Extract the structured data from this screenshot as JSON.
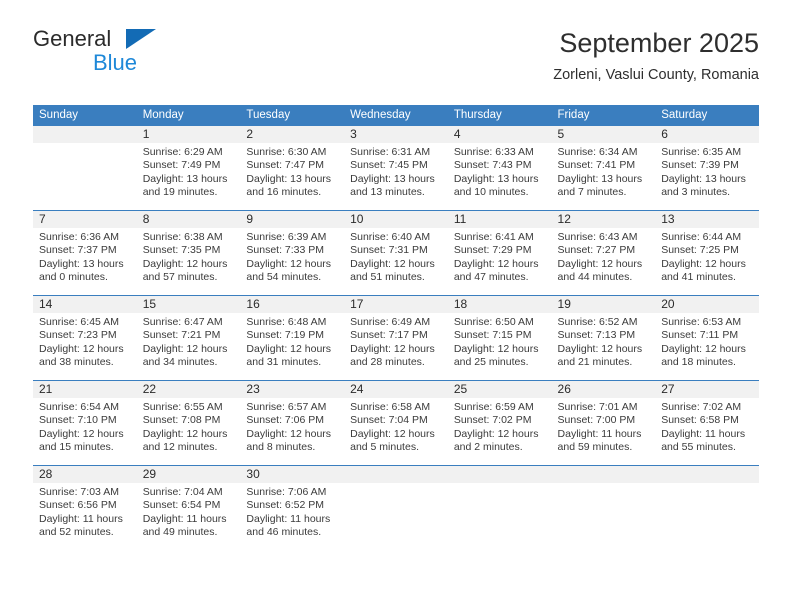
{
  "brand": {
    "name_part1": "General",
    "name_part2": "Blue",
    "triangle_color": "#136bb5",
    "blue_color": "#1e88d8"
  },
  "header": {
    "title": "September 2025",
    "subtitle": "Zorleni, Vaslui County, Romania"
  },
  "theme": {
    "header_bg": "#3a7ebf",
    "header_text": "#ffffff",
    "daynum_bg": "#f1f1f1",
    "row_divider": "#3a7ebf"
  },
  "weekdays": [
    "Sunday",
    "Monday",
    "Tuesday",
    "Wednesday",
    "Thursday",
    "Friday",
    "Saturday"
  ],
  "weeks": [
    [
      {
        "day": "",
        "sunrise": "",
        "sunset": "",
        "daylight1": "",
        "daylight2": ""
      },
      {
        "day": "1",
        "sunrise": "Sunrise: 6:29 AM",
        "sunset": "Sunset: 7:49 PM",
        "daylight1": "Daylight: 13 hours",
        "daylight2": "and 19 minutes."
      },
      {
        "day": "2",
        "sunrise": "Sunrise: 6:30 AM",
        "sunset": "Sunset: 7:47 PM",
        "daylight1": "Daylight: 13 hours",
        "daylight2": "and 16 minutes."
      },
      {
        "day": "3",
        "sunrise": "Sunrise: 6:31 AM",
        "sunset": "Sunset: 7:45 PM",
        "daylight1": "Daylight: 13 hours",
        "daylight2": "and 13 minutes."
      },
      {
        "day": "4",
        "sunrise": "Sunrise: 6:33 AM",
        "sunset": "Sunset: 7:43 PM",
        "daylight1": "Daylight: 13 hours",
        "daylight2": "and 10 minutes."
      },
      {
        "day": "5",
        "sunrise": "Sunrise: 6:34 AM",
        "sunset": "Sunset: 7:41 PM",
        "daylight1": "Daylight: 13 hours",
        "daylight2": "and 7 minutes."
      },
      {
        "day": "6",
        "sunrise": "Sunrise: 6:35 AM",
        "sunset": "Sunset: 7:39 PM",
        "daylight1": "Daylight: 13 hours",
        "daylight2": "and 3 minutes."
      }
    ],
    [
      {
        "day": "7",
        "sunrise": "Sunrise: 6:36 AM",
        "sunset": "Sunset: 7:37 PM",
        "daylight1": "Daylight: 13 hours",
        "daylight2": "and 0 minutes."
      },
      {
        "day": "8",
        "sunrise": "Sunrise: 6:38 AM",
        "sunset": "Sunset: 7:35 PM",
        "daylight1": "Daylight: 12 hours",
        "daylight2": "and 57 minutes."
      },
      {
        "day": "9",
        "sunrise": "Sunrise: 6:39 AM",
        "sunset": "Sunset: 7:33 PM",
        "daylight1": "Daylight: 12 hours",
        "daylight2": "and 54 minutes."
      },
      {
        "day": "10",
        "sunrise": "Sunrise: 6:40 AM",
        "sunset": "Sunset: 7:31 PM",
        "daylight1": "Daylight: 12 hours",
        "daylight2": "and 51 minutes."
      },
      {
        "day": "11",
        "sunrise": "Sunrise: 6:41 AM",
        "sunset": "Sunset: 7:29 PM",
        "daylight1": "Daylight: 12 hours",
        "daylight2": "and 47 minutes."
      },
      {
        "day": "12",
        "sunrise": "Sunrise: 6:43 AM",
        "sunset": "Sunset: 7:27 PM",
        "daylight1": "Daylight: 12 hours",
        "daylight2": "and 44 minutes."
      },
      {
        "day": "13",
        "sunrise": "Sunrise: 6:44 AM",
        "sunset": "Sunset: 7:25 PM",
        "daylight1": "Daylight: 12 hours",
        "daylight2": "and 41 minutes."
      }
    ],
    [
      {
        "day": "14",
        "sunrise": "Sunrise: 6:45 AM",
        "sunset": "Sunset: 7:23 PM",
        "daylight1": "Daylight: 12 hours",
        "daylight2": "and 38 minutes."
      },
      {
        "day": "15",
        "sunrise": "Sunrise: 6:47 AM",
        "sunset": "Sunset: 7:21 PM",
        "daylight1": "Daylight: 12 hours",
        "daylight2": "and 34 minutes."
      },
      {
        "day": "16",
        "sunrise": "Sunrise: 6:48 AM",
        "sunset": "Sunset: 7:19 PM",
        "daylight1": "Daylight: 12 hours",
        "daylight2": "and 31 minutes."
      },
      {
        "day": "17",
        "sunrise": "Sunrise: 6:49 AM",
        "sunset": "Sunset: 7:17 PM",
        "daylight1": "Daylight: 12 hours",
        "daylight2": "and 28 minutes."
      },
      {
        "day": "18",
        "sunrise": "Sunrise: 6:50 AM",
        "sunset": "Sunset: 7:15 PM",
        "daylight1": "Daylight: 12 hours",
        "daylight2": "and 25 minutes."
      },
      {
        "day": "19",
        "sunrise": "Sunrise: 6:52 AM",
        "sunset": "Sunset: 7:13 PM",
        "daylight1": "Daylight: 12 hours",
        "daylight2": "and 21 minutes."
      },
      {
        "day": "20",
        "sunrise": "Sunrise: 6:53 AM",
        "sunset": "Sunset: 7:11 PM",
        "daylight1": "Daylight: 12 hours",
        "daylight2": "and 18 minutes."
      }
    ],
    [
      {
        "day": "21",
        "sunrise": "Sunrise: 6:54 AM",
        "sunset": "Sunset: 7:10 PM",
        "daylight1": "Daylight: 12 hours",
        "daylight2": "and 15 minutes."
      },
      {
        "day": "22",
        "sunrise": "Sunrise: 6:55 AM",
        "sunset": "Sunset: 7:08 PM",
        "daylight1": "Daylight: 12 hours",
        "daylight2": "and 12 minutes."
      },
      {
        "day": "23",
        "sunrise": "Sunrise: 6:57 AM",
        "sunset": "Sunset: 7:06 PM",
        "daylight1": "Daylight: 12 hours",
        "daylight2": "and 8 minutes."
      },
      {
        "day": "24",
        "sunrise": "Sunrise: 6:58 AM",
        "sunset": "Sunset: 7:04 PM",
        "daylight1": "Daylight: 12 hours",
        "daylight2": "and 5 minutes."
      },
      {
        "day": "25",
        "sunrise": "Sunrise: 6:59 AM",
        "sunset": "Sunset: 7:02 PM",
        "daylight1": "Daylight: 12 hours",
        "daylight2": "and 2 minutes."
      },
      {
        "day": "26",
        "sunrise": "Sunrise: 7:01 AM",
        "sunset": "Sunset: 7:00 PM",
        "daylight1": "Daylight: 11 hours",
        "daylight2": "and 59 minutes."
      },
      {
        "day": "27",
        "sunrise": "Sunrise: 7:02 AM",
        "sunset": "Sunset: 6:58 PM",
        "daylight1": "Daylight: 11 hours",
        "daylight2": "and 55 minutes."
      }
    ],
    [
      {
        "day": "28",
        "sunrise": "Sunrise: 7:03 AM",
        "sunset": "Sunset: 6:56 PM",
        "daylight1": "Daylight: 11 hours",
        "daylight2": "and 52 minutes."
      },
      {
        "day": "29",
        "sunrise": "Sunrise: 7:04 AM",
        "sunset": "Sunset: 6:54 PM",
        "daylight1": "Daylight: 11 hours",
        "daylight2": "and 49 minutes."
      },
      {
        "day": "30",
        "sunrise": "Sunrise: 7:06 AM",
        "sunset": "Sunset: 6:52 PM",
        "daylight1": "Daylight: 11 hours",
        "daylight2": "and 46 minutes."
      },
      {
        "day": "",
        "sunrise": "",
        "sunset": "",
        "daylight1": "",
        "daylight2": ""
      },
      {
        "day": "",
        "sunrise": "",
        "sunset": "",
        "daylight1": "",
        "daylight2": ""
      },
      {
        "day": "",
        "sunrise": "",
        "sunset": "",
        "daylight1": "",
        "daylight2": ""
      },
      {
        "day": "",
        "sunrise": "",
        "sunset": "",
        "daylight1": "",
        "daylight2": ""
      }
    ]
  ]
}
